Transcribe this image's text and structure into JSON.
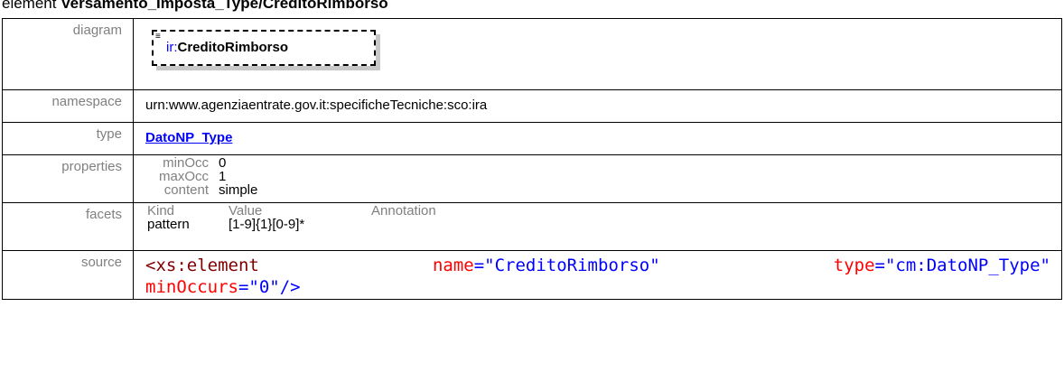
{
  "heading": {
    "prefix": "element",
    "name": "Versamento_Imposta_Type/CreditoRimborso"
  },
  "rows": {
    "diagram": {
      "label": "diagram",
      "box_prefix": "ir:",
      "box_name": "CreditoRimborso"
    },
    "namespace": {
      "label": "namespace",
      "value": "urn:www.agenziaentrate.gov.it:specificheTecniche:sco:ira"
    },
    "type": {
      "label": "type",
      "value": "DatoNP_Type"
    },
    "properties": {
      "label": "properties",
      "items": [
        {
          "key": "minOcc",
          "value": "0"
        },
        {
          "key": "maxOcc",
          "value": "1"
        },
        {
          "key": "content",
          "value": "simple"
        }
      ]
    },
    "facets": {
      "label": "facets",
      "headers": [
        "Kind",
        "Value",
        "Annotation"
      ],
      "rows": [
        {
          "kind": "pattern",
          "value": "[1-9]{1}[0-9]*",
          "annotation": ""
        }
      ]
    },
    "source": {
      "label": "source",
      "tag_open": "<xs:element",
      "attr_name": "name",
      "attr_name_value": "\"CreditoRimborso\"",
      "attr_type": "type",
      "attr_type_value": "\"cm:DatoNP_Type\"",
      "attr_min": "minOccurs",
      "attr_min_value": "\"0\"",
      "tag_close": "/>"
    }
  },
  "colors": {
    "label_gray": "#808080",
    "link_blue": "#0000ff",
    "xml_tag": "#800000",
    "xml_attr": "#ff0000"
  },
  "icons": {
    "diagram_lines": "lines-icon"
  }
}
